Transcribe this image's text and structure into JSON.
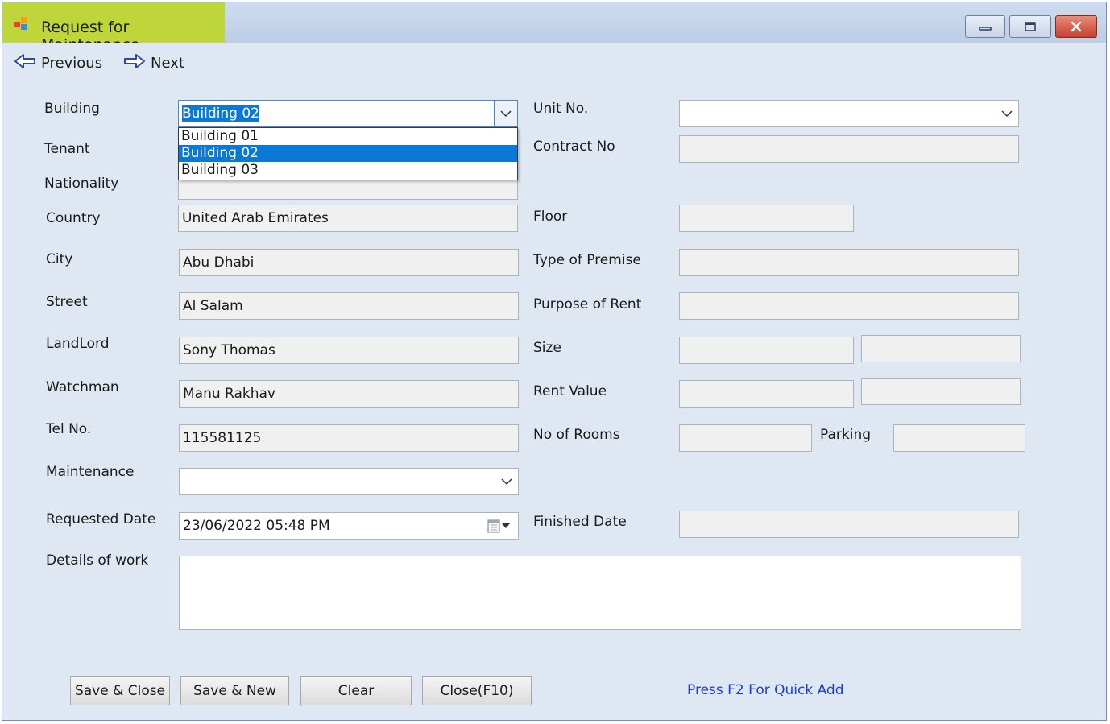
{
  "window": {
    "title": "Request for Maintenance",
    "accent_color": "#bfd63a",
    "controls": {
      "minimize": "minimize-icon",
      "maximize": "maximize-icon",
      "close": "close-icon"
    }
  },
  "nav": {
    "previous": "Previous",
    "next": "Next"
  },
  "left": {
    "building_label": "Building",
    "building_value": "Building 02",
    "building_options": [
      "Building 01",
      "Building 02",
      "Building 03"
    ],
    "building_selected_index": 1,
    "tenant_label": "Tenant",
    "nationality_label": "Nationality",
    "country_label": "Country",
    "country_value": "United Arab Emirates",
    "city_label": "City",
    "city_value": "Abu Dhabi",
    "street_label": "Street",
    "street_value": "Al Salam",
    "landlord_label": "LandLord",
    "landlord_value": "Sony Thomas",
    "watchman_label": "Watchman",
    "watchman_value": "Manu Rakhav",
    "tel_label": "Tel No.",
    "tel_value": "115581125",
    "maintenance_label": "Maintenance",
    "maintenance_value": "",
    "requested_date_label": "Requested Date",
    "requested_date_value": "23/06/2022 05:48 PM",
    "details_label": "Details of work",
    "details_value": ""
  },
  "right": {
    "unit_label": "Unit No.",
    "unit_value": "",
    "contract_label": "Contract No",
    "floor_label": "Floor",
    "premise_label": "Type of Premise",
    "purpose_label": "Purpose of Rent",
    "size_label": "Size",
    "rent_label": "Rent Value",
    "rooms_label": "No of Rooms",
    "parking_label": "Parking",
    "finished_label": "Finished Date"
  },
  "buttons": {
    "save_close": "Save & Close",
    "save_new": "Save & New",
    "clear": "Clear",
    "close": "Close(F10)"
  },
  "hint": "Press F2 For Quick Add",
  "colors": {
    "hint": "#1b3fd1",
    "selection": "#0a78d7"
  }
}
